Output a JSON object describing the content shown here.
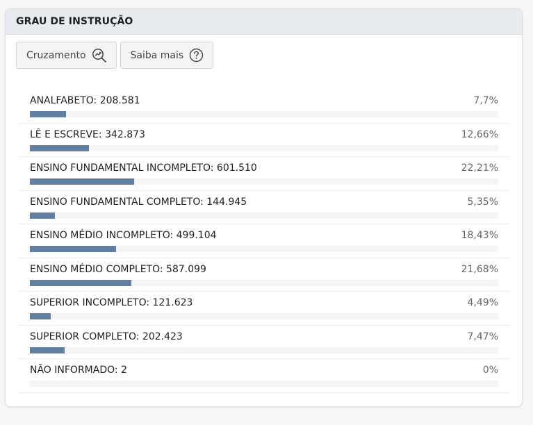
{
  "card": {
    "title": "GRAU DE INSTRUÇÃO"
  },
  "toolbar": {
    "cruzamento_label": "Cruzamento",
    "saiba_mais_label": "Saiba mais"
  },
  "colors": {
    "bar_fill": "#637fa0",
    "bar_track": "#f5f5f5",
    "header_bg": "#e8ebef"
  },
  "rows": [
    {
      "label": "ANALFABETO: 208.581",
      "percent": "7,7%",
      "fraction": 0.077
    },
    {
      "label": "LÊ E ESCREVE: 342.873",
      "percent": "12,66%",
      "fraction": 0.1266
    },
    {
      "label": "ENSINO FUNDAMENTAL INCOMPLETO: 601.510",
      "percent": "22,21%",
      "fraction": 0.2221
    },
    {
      "label": "ENSINO FUNDAMENTAL COMPLETO: 144.945",
      "percent": "5,35%",
      "fraction": 0.0535
    },
    {
      "label": "ENSINO MÉDIO INCOMPLETO: 499.104",
      "percent": "18,43%",
      "fraction": 0.1843
    },
    {
      "label": "ENSINO MÉDIO COMPLETO: 587.099",
      "percent": "21,68%",
      "fraction": 0.2168
    },
    {
      "label": "SUPERIOR INCOMPLETO: 121.623",
      "percent": "4,49%",
      "fraction": 0.0449
    },
    {
      "label": "SUPERIOR COMPLETO: 202.423",
      "percent": "7,47%",
      "fraction": 0.0747
    },
    {
      "label": "NÃO INFORMADO: 2",
      "percent": "0%",
      "fraction": 0
    }
  ]
}
